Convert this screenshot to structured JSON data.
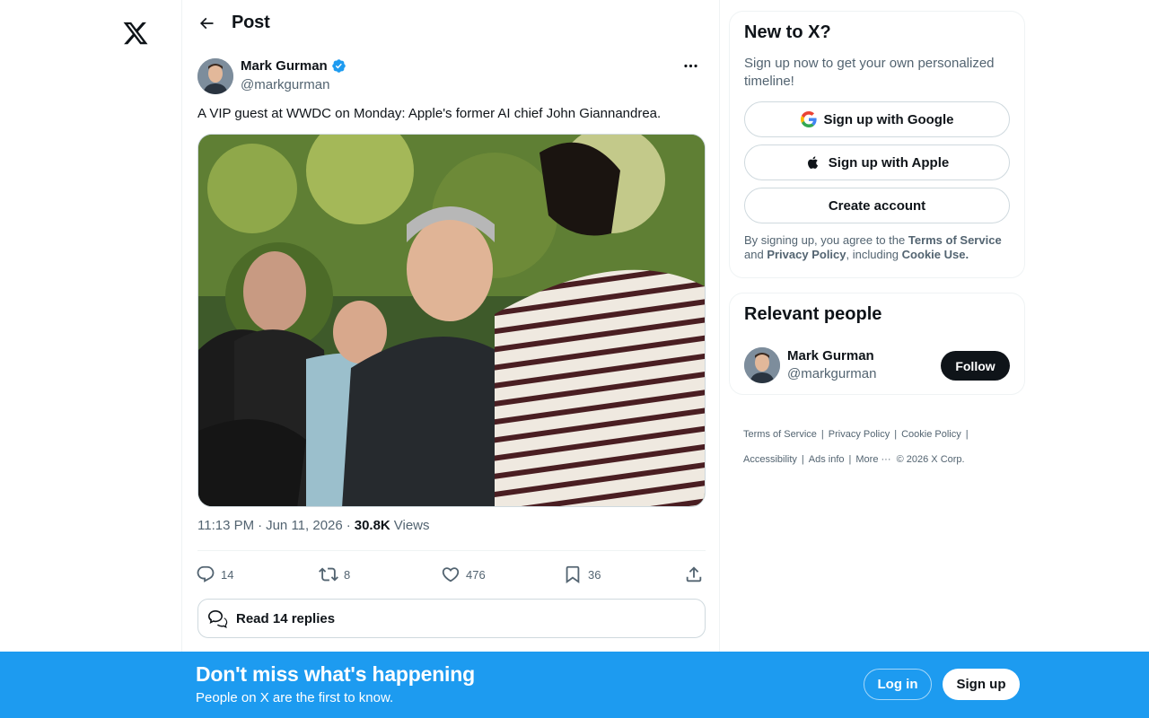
{
  "header": {
    "title": "Post"
  },
  "post": {
    "author_name": "Mark Gurman",
    "author_handle": "@markgurman",
    "text": "A VIP guest at WWDC on Monday: Apple's former AI chief John Giannandrea.",
    "time": "11:13 PM",
    "date": "Jun 11, 2026",
    "views_count": "30.8K",
    "views_label": "Views",
    "replies": "14",
    "reposts": "8",
    "likes": "476",
    "bookmarks": "36",
    "read_replies": "Read 14 replies"
  },
  "signup_card": {
    "title": "New to X?",
    "subtitle": "Sign up now to get your own personalized timeline!",
    "google_label": "Sign up with Google",
    "apple_label": "Sign up with Apple",
    "create_label": "Create account",
    "legal_prefix": "By signing up, you agree to the",
    "terms": "Terms of Service",
    "and": "and",
    "privacy": "Privacy Policy",
    "including": ", including",
    "cookie": "Cookie Use."
  },
  "relevant": {
    "title": "Relevant people",
    "name": "Mark Gurman",
    "handle": "@markgurman",
    "follow_label": "Follow"
  },
  "footer": {
    "terms": "Terms of Service",
    "privacy": "Privacy Policy",
    "cookie": "Cookie Policy",
    "accessibility": "Accessibility",
    "ads": "Ads info",
    "more": "More ···",
    "copyright": "© 2026 X Corp."
  },
  "bottom_bar": {
    "title": "Don't miss what's happening",
    "subtitle": "People on X are the first to know.",
    "login": "Log in",
    "signup": "Sign up"
  },
  "icons": {
    "logo": "x-logo-icon",
    "back": "arrow-left-icon",
    "verified": "verified-badge-icon",
    "more": "more-horizontal-icon",
    "reply": "reply-icon",
    "repost": "repost-icon",
    "like": "heart-icon",
    "bookmark": "bookmark-icon",
    "share": "share-icon",
    "google": "google-icon",
    "apple": "apple-icon"
  },
  "colors": {
    "accent": "#1d9bf0",
    "text": "#0f1419",
    "muted": "#536471"
  }
}
